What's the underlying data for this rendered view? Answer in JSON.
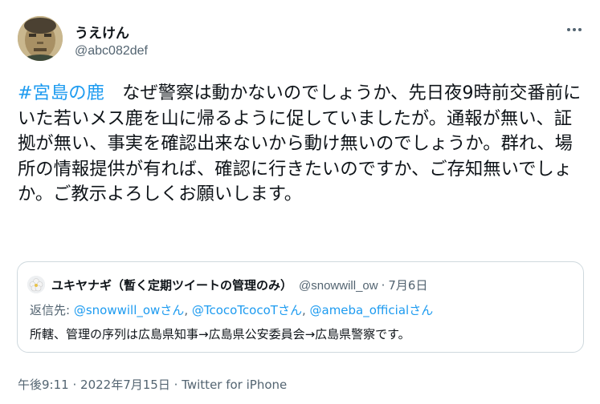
{
  "author": {
    "display_name": "うえけん",
    "handle": "@abc082def"
  },
  "tweet": {
    "hashtag": "#宮島の鹿",
    "text": "　なぜ警察は動かないのでしょうか、先日夜9時前交番前にいた若いメス鹿を山に帰るように促していましたが。通報が無い、証拠が無い、事実を確認出来ないから動け無いのでしょうか。群れ、場所の情報提供が有れば、確認に行きたいのですか、ご存知無いでしょか。ご教示よろしくお願いします。"
  },
  "quoted_tweet": {
    "display_name": "ユキヤナギ（暫く定期ツイートの管理のみ）",
    "handle": "@snowwill_ow",
    "separator": "·",
    "date": "7月6日",
    "reply_prefix": "返信先: ",
    "reply_mentions": [
      "@snowwill_owさん",
      "@TcocoTcocoTさん",
      "@ameba_officialさん"
    ],
    "reply_separator": ", ",
    "text": "所轄、管理の序列は広島県知事→広島県公安委員会→広島県警察です。"
  },
  "meta": {
    "time": "午後9:11",
    "separator": "·",
    "date": "2022年7月15日",
    "source": "Twitter for iPhone"
  },
  "icons": {
    "more": "more-dots-icon"
  },
  "colors": {
    "link": "#1d9bf0",
    "secondary_text": "#536471",
    "border": "#cfd9de"
  }
}
